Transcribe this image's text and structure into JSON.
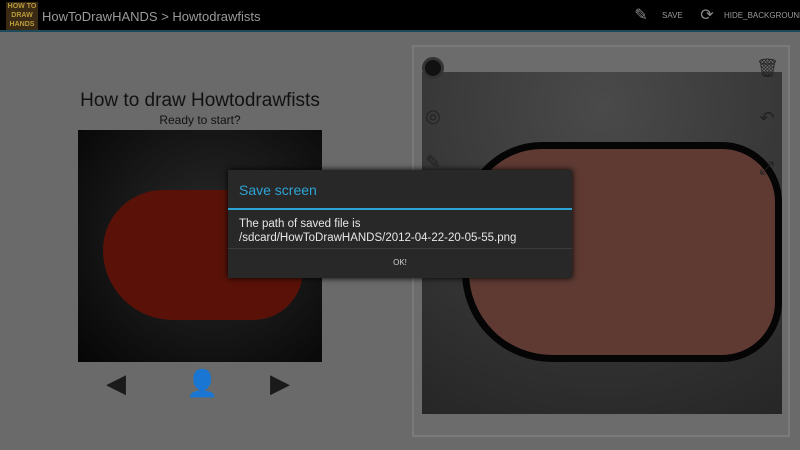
{
  "app": {
    "logo_text": "HOW TO DRAW HANDS",
    "breadcrumb": "HowToDrawHANDS > Howtodrawfists"
  },
  "actions": {
    "save": "SAVE",
    "hide_background": "HIDE_BACKGROUND"
  },
  "lesson": {
    "title": "How to draw Howtodrawfists",
    "subtitle": "Ready to start?"
  },
  "dialog": {
    "title": "Save screen",
    "line1": "The path of saved file is",
    "line2": "/sdcard/HowToDrawHANDS/2012-04-22-20-05-55.png",
    "ok": "OK!"
  }
}
